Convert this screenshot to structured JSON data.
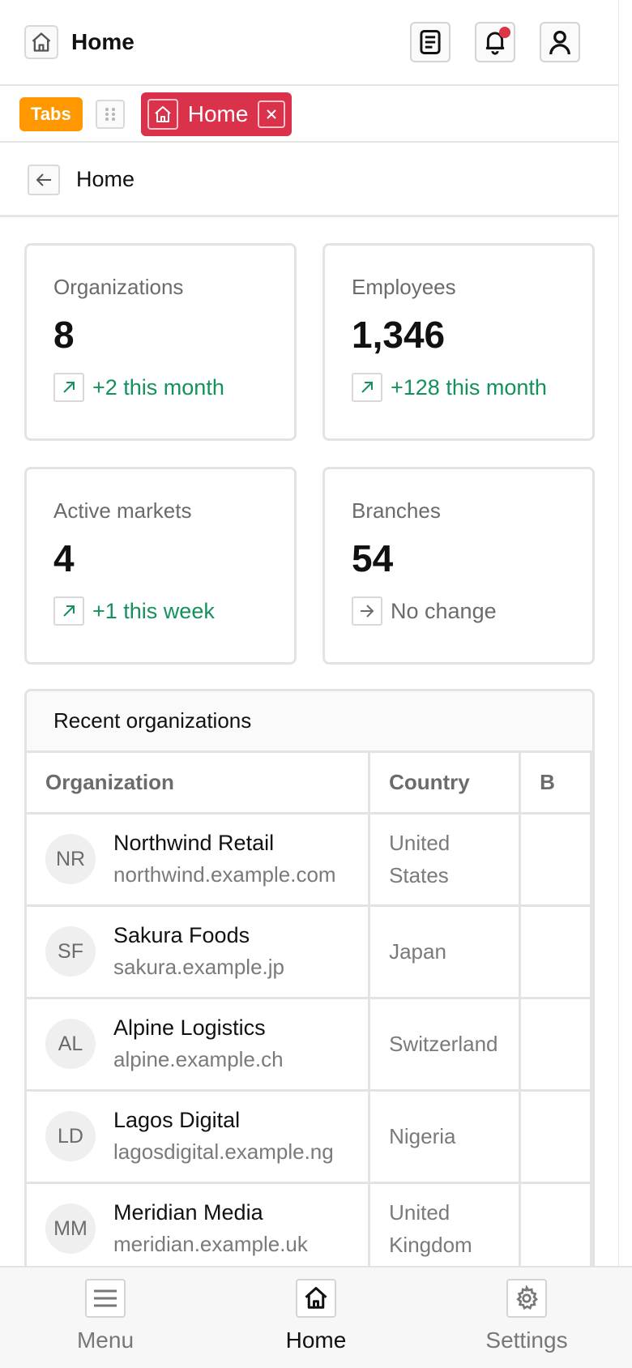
{
  "header": {
    "title": "Home",
    "icons": {
      "home": "home-icon",
      "document": "document-icon",
      "bell": "bell-icon",
      "user": "user-icon"
    }
  },
  "tabs": {
    "badge": "Tabs",
    "active_tab": {
      "label": "Home"
    }
  },
  "breadcrumb": {
    "title": "Home"
  },
  "stats": [
    {
      "label": "Organizations",
      "value": "8",
      "delta": "+2 this month",
      "trend": "up"
    },
    {
      "label": "Employees",
      "value": "1,346",
      "delta": "+128 this month",
      "trend": "up"
    },
    {
      "label": "Active markets",
      "value": "4",
      "delta": "+1 this week",
      "trend": "up"
    },
    {
      "label": "Branches",
      "value": "54",
      "delta": "No change",
      "trend": "flat"
    }
  ],
  "recent": {
    "title": "Recent organizations",
    "columns": [
      "Organization",
      "Country",
      "B"
    ],
    "rows": [
      {
        "initials": "NR",
        "name": "Northwind Retail",
        "domain": "northwind.example.com",
        "country_line1": "United",
        "country_line2": "States"
      },
      {
        "initials": "SF",
        "name": "Sakura Foods",
        "domain": "sakura.example.jp",
        "country_line1": "Japan",
        "country_line2": ""
      },
      {
        "initials": "AL",
        "name": "Alpine Logistics",
        "domain": "alpine.example.ch",
        "country_line1": "Switzerland",
        "country_line2": ""
      },
      {
        "initials": "LD",
        "name": "Lagos Digital",
        "domain": "lagosdigital.example.ng",
        "country_line1": "Nigeria",
        "country_line2": ""
      },
      {
        "initials": "MM",
        "name": "Meridian Media",
        "domain": "meridian.example.uk",
        "country_line1": "United",
        "country_line2": "Kingdom"
      }
    ]
  },
  "bottom_nav": [
    {
      "label": "Menu",
      "icon": "menu-icon"
    },
    {
      "label": "Home",
      "icon": "home-icon"
    },
    {
      "label": "Settings",
      "icon": "gear-icon"
    }
  ],
  "colors": {
    "accent_tab": "#d9324a",
    "tabs_badge": "#ff9800",
    "positive": "#14915c",
    "notification": "#dc3545"
  }
}
